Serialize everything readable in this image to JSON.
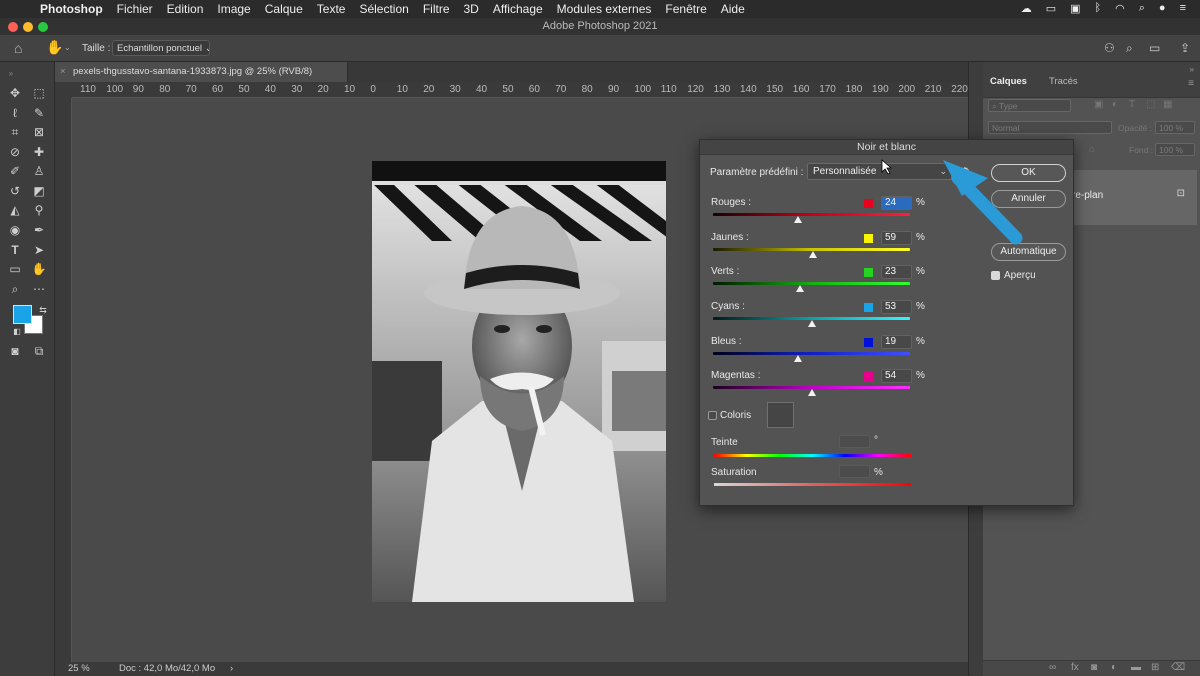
{
  "menubar": {
    "items": [
      "Photoshop",
      "Fichier",
      "Edition",
      "Image",
      "Calque",
      "Texte",
      "Sélection",
      "Filtre",
      "3D",
      "Affichage",
      "Modules externes",
      "Fenêtre",
      "Aide"
    ]
  },
  "window": {
    "title": "Adobe Photoshop 2021"
  },
  "options_bar": {
    "size_label": "Taille :",
    "size_value": "Echantillon ponctuel"
  },
  "document": {
    "tab_title": "pexels-thgusstavo-santana-1933873.jpg @ 25% (RVB/8)"
  },
  "ruler": {
    "h_ticks": [
      "110",
      "100",
      "90",
      "80",
      "70",
      "60",
      "50",
      "40",
      "30",
      "20",
      "10",
      "0",
      "10",
      "20",
      "30",
      "40",
      "50",
      "60",
      "70",
      "80",
      "90",
      "100",
      "110",
      "120",
      "130",
      "140",
      "150",
      "160",
      "170",
      "180",
      "190",
      "200",
      "210",
      "220"
    ]
  },
  "status": {
    "zoom": "25 %",
    "doc": "Doc : 42,0 Mo/42,0 Mo"
  },
  "layers_panel": {
    "tabs": [
      "Calques",
      "Tracés"
    ],
    "filter_placeholder": "Type",
    "blend_mode": "Normal",
    "opacity_label": "Opacité :",
    "opacity_value": "100 %",
    "fill_label": "Fond :",
    "fill_value": "100 %",
    "layer_name_partial": "re-plan"
  },
  "dialog": {
    "title": "Noir et blanc",
    "preset_label": "Paramètre prédéfini :",
    "preset_value": "Personnalisée",
    "ok": "OK",
    "cancel": "Annuler",
    "auto": "Automatique",
    "preview": "Aperçu",
    "tint": "Coloris",
    "hue_label": "Teinte",
    "hue_unit": "°",
    "sat_label": "Saturation",
    "sat_unit": "%",
    "unit": "%",
    "channels": [
      {
        "label": "Rouges :",
        "value": "24",
        "swatch": "#e8001c",
        "gradient": "linear-gradient(90deg,#1a0000,#c7001a,#ff1e3c)",
        "fraction": 0.43
      },
      {
        "label": "Jaunes :",
        "value": "59",
        "swatch": "#f8f400",
        "gradient": "linear-gradient(90deg,#1a1a00,#c9c400,#ffff2a)",
        "fraction": 0.51
      },
      {
        "label": "Verts :",
        "value": "23",
        "swatch": "#25d321",
        "gradient": "linear-gradient(90deg,#001a00,#14b010,#33ff30)",
        "fraction": 0.44
      },
      {
        "label": "Cyans :",
        "value": "53",
        "swatch": "#1aa4e8",
        "gradient": "linear-gradient(90deg,#001a1a,#08a4a8,#33f5ff)",
        "fraction": 0.5
      },
      {
        "label": "Bleus :",
        "value": "19",
        "swatch": "#0010d8",
        "gradient": "linear-gradient(90deg,#00001a,#1020c8,#4050ff)",
        "fraction": 0.43
      },
      {
        "label": "Magentas :",
        "value": "54",
        "swatch": "#e8008c",
        "gradient": "linear-gradient(90deg,#1a001a,#c000c8,#ff30ff)",
        "fraction": 0.5
      }
    ]
  },
  "colors": {
    "foreground": "#1aa3e6",
    "background": "#ffffff",
    "annotation_arrow": "#2a9bd6"
  }
}
